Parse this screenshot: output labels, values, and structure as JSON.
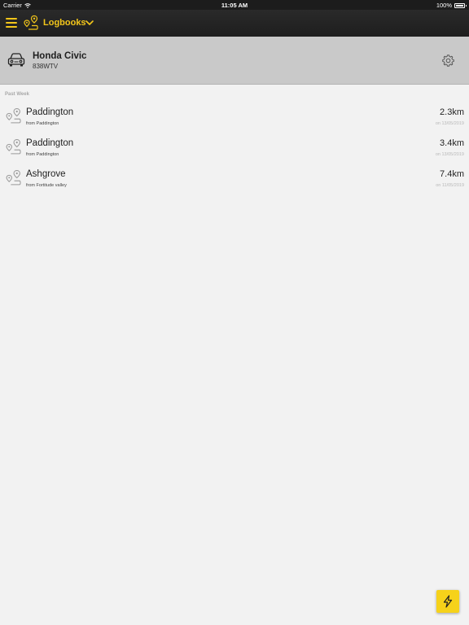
{
  "status_bar": {
    "carrier": "Carrier",
    "time": "11:05 AM",
    "battery": "100%"
  },
  "nav": {
    "title": "Logbooks",
    "accent_color": "#f3c61a"
  },
  "vehicle": {
    "name": "Honda Civic",
    "plate": "838WTV"
  },
  "section_label": "Past Week",
  "trips": [
    {
      "destination": "Paddington",
      "origin": "from Paddington",
      "distance": "2.3km",
      "date": "on 13/05/2019"
    },
    {
      "destination": "Paddington",
      "origin": "from Paddington",
      "distance": "3.4km",
      "date": "on 13/05/2019"
    },
    {
      "destination": "Ashgrove",
      "origin": "from Fortitude valley",
      "distance": "7.4km",
      "date": "on 11/05/2019"
    }
  ],
  "icons": {
    "menu": "hamburger-menu-icon",
    "logo": "route-pin-icon",
    "dropdown": "chevron-down-icon",
    "vehicle": "car-icon",
    "settings": "gear-icon",
    "trip": "route-pin-icon",
    "quick_action": "lightning-bolt-icon"
  }
}
